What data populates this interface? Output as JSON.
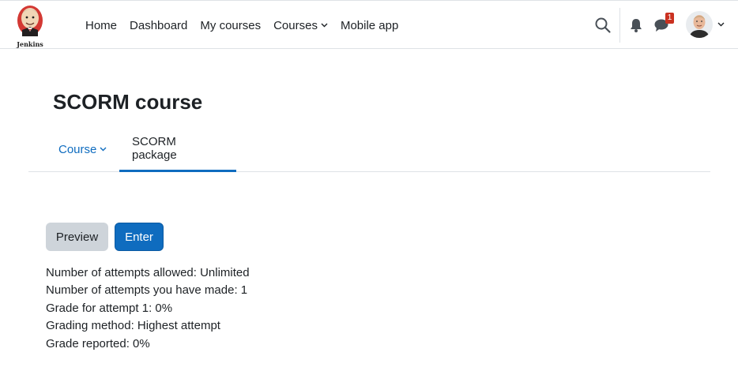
{
  "navbar": {
    "logo_text": "Jenkins",
    "links": [
      {
        "label": "Home"
      },
      {
        "label": "Dashboard"
      },
      {
        "label": "My courses"
      },
      {
        "label": "Courses",
        "has_dropdown": true
      },
      {
        "label": "Mobile app"
      }
    ],
    "message_badge": "1",
    "icons": {
      "search": "search-icon",
      "notifications": "bell-icon",
      "messages": "chat-bubble-icon",
      "user_menu": "chevron-down-icon"
    }
  },
  "page": {
    "title": "SCORM course"
  },
  "tabs": [
    {
      "label": "Course",
      "has_dropdown": true,
      "active": false
    },
    {
      "label": "SCORM package",
      "active": true
    }
  ],
  "buttons": {
    "preview": "Preview",
    "enter": "Enter"
  },
  "info": [
    "Number of attempts allowed: Unlimited",
    "Number of attempts you have made: 1",
    "Grade for attempt 1: 0%",
    "Grading method: Highest attempt",
    "Grade reported: 0%"
  ],
  "colors": {
    "primary": "#0f6cbf",
    "secondary_button": "#ced4da",
    "badge": "#ca3120",
    "border": "#dee2e6",
    "text": "#1d2125"
  }
}
